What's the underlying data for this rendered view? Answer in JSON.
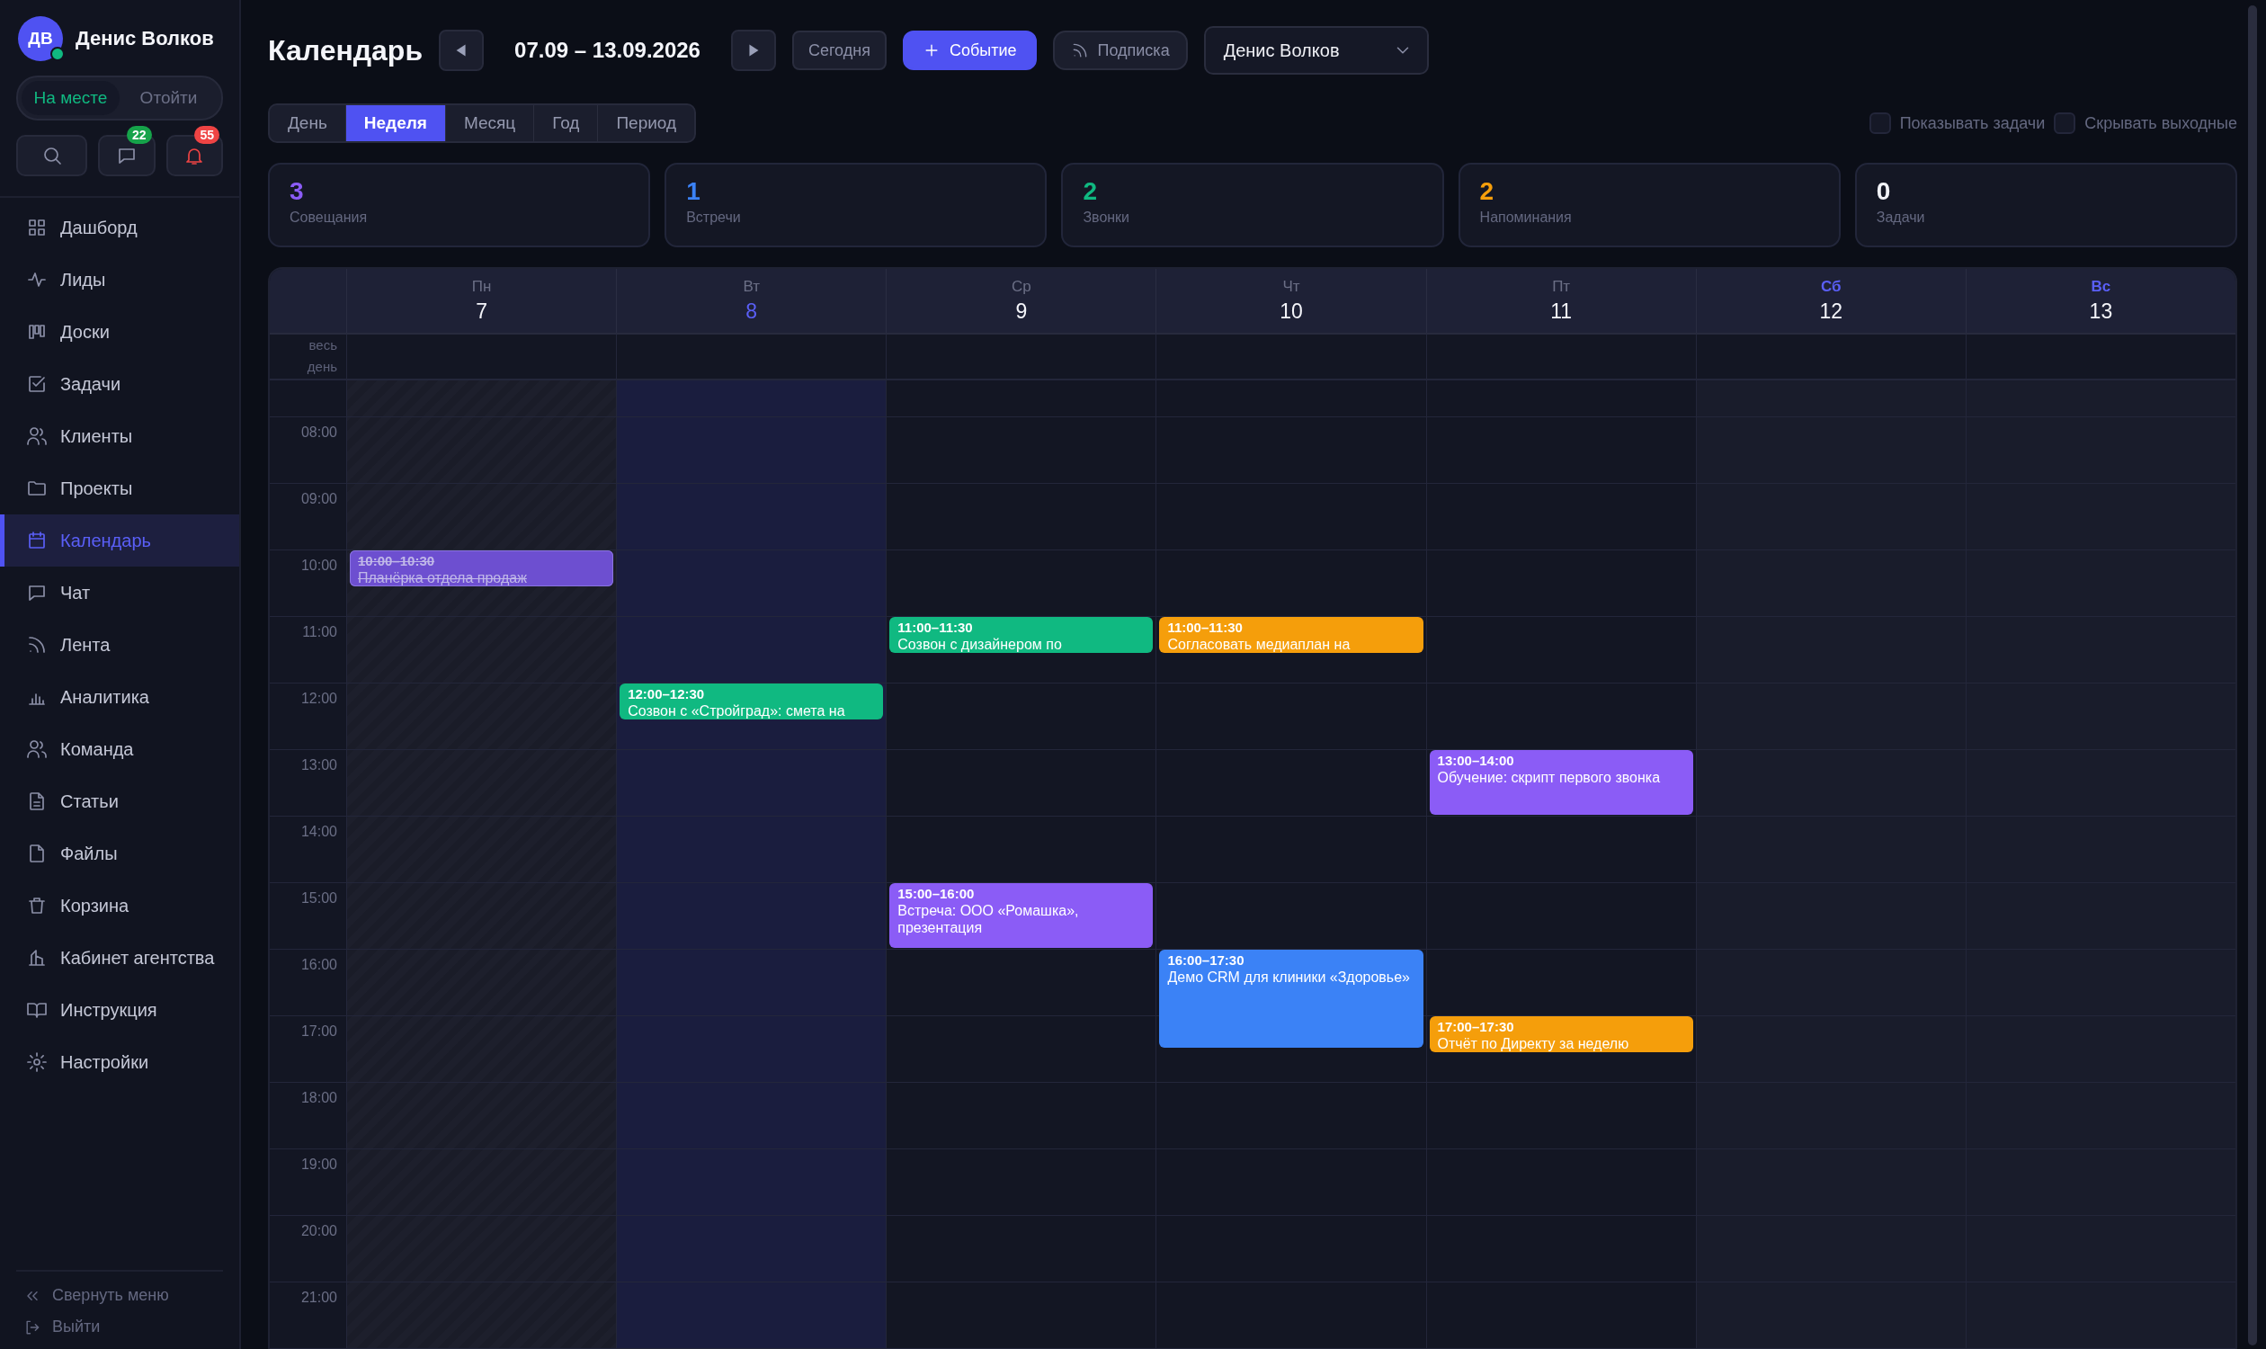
{
  "sidebar": {
    "user": {
      "initials": "ДВ",
      "name": "Денис Волков",
      "online": true
    },
    "status": [
      {
        "label": "На месте",
        "selected": true
      },
      {
        "label": "Отойти",
        "selected": false
      }
    ],
    "badges": [
      "22",
      "55"
    ],
    "items": [
      {
        "label": "Дашборд",
        "selected": false
      },
      {
        "label": "Лиды",
        "selected": false
      },
      {
        "label": "Доски",
        "selected": false
      },
      {
        "label": "Задачи",
        "selected": false
      },
      {
        "label": "Клиенты",
        "selected": false
      },
      {
        "label": "Проекты",
        "selected": false
      },
      {
        "label": "Календарь",
        "selected": true
      },
      {
        "label": "Чат",
        "selected": false
      },
      {
        "label": "Лента",
        "selected": false
      },
      {
        "label": "Аналитика",
        "selected": false
      },
      {
        "label": "Команда",
        "selected": false
      },
      {
        "label": "Статьи",
        "selected": false
      },
      {
        "label": "Файлы",
        "selected": false
      },
      {
        "label": "Корзина",
        "selected": false
      },
      {
        "label": "Кабинет агентства",
        "selected": false
      },
      {
        "label": "Инструкция",
        "selected": false
      },
      {
        "label": "Настройки",
        "selected": false
      }
    ],
    "collapse": "Свернуть меню",
    "logout": "Выйти"
  },
  "toolbar": {
    "title": "Календарь",
    "range": "07.09 – 13.09.2026",
    "today": "Сегодня",
    "new_event": "Событие",
    "subscribe": "Подписка",
    "user_select": "Денис Волков"
  },
  "views": [
    {
      "label": "День",
      "selected": false
    },
    {
      "label": "Неделя",
      "selected": true
    },
    {
      "label": "Месяц",
      "selected": false
    },
    {
      "label": "Год",
      "selected": false
    },
    {
      "label": "Период",
      "selected": false
    }
  ],
  "options": [
    {
      "label": "Показывать задачи",
      "checked": false
    },
    {
      "label": "Скрывать выходные",
      "checked": false
    }
  ],
  "stats": [
    {
      "value": "3",
      "label": "Совещания",
      "color": "#8b5cf6"
    },
    {
      "value": "1",
      "label": "Встречи",
      "color": "#3b82f6"
    },
    {
      "value": "2",
      "label": "Звонки",
      "color": "#10b981"
    },
    {
      "value": "2",
      "label": "Напоминания",
      "color": "#f59e0b"
    },
    {
      "value": "0",
      "label": "Задачи",
      "color": "#f1f2f7"
    }
  ],
  "all_day_label": "весь день",
  "hours": [
    "08:00",
    "09:00",
    "10:00",
    "11:00",
    "12:00",
    "13:00",
    "14:00",
    "15:00",
    "16:00",
    "17:00",
    "18:00",
    "19:00",
    "20:00",
    "21:00"
  ],
  "days": [
    {
      "weekday": "Пн",
      "date": "7",
      "kind": "past",
      "events": [
        {
          "time": "10:00–10:30",
          "title": "Планёрка отдела продаж",
          "color": "#6d4fd0",
          "done": true
        }
      ]
    },
    {
      "weekday": "Вт",
      "date": "8",
      "kind": "today",
      "events": [
        {
          "time": "12:00–12:30",
          "title": "Созвон с «Стройград»: смета на",
          "color": "#10b981",
          "done": false
        }
      ]
    },
    {
      "weekday": "Ср",
      "date": "9",
      "kind": "normal",
      "events": [
        {
          "time": "11:00–11:30",
          "title": "Созвон с дизайнером по",
          "color": "#10b981",
          "done": false
        },
        {
          "time": "15:00–16:00",
          "title": "Встреча: ООО «Ромашка», презентация",
          "color": "#8b5cf6",
          "done": false
        }
      ]
    },
    {
      "weekday": "Чт",
      "date": "10",
      "kind": "normal",
      "events": [
        {
          "time": "11:00–11:30",
          "title": "Согласовать медиаплан на",
          "color": "#f59e0b",
          "done": false
        },
        {
          "time": "16:00–17:30",
          "title": "Демо CRM для клиники «Здоровье»",
          "color": "#3b82f6",
          "done": false
        }
      ]
    },
    {
      "weekday": "Пт",
      "date": "11",
      "kind": "normal",
      "events": [
        {
          "time": "13:00–14:00",
          "title": "Обучение: скрипт первого звонка",
          "color": "#8b5cf6",
          "done": false
        },
        {
          "time": "17:00–17:30",
          "title": "Отчёт по Директу за неделю",
          "color": "#f59e0b",
          "done": false
        }
      ]
    },
    {
      "weekday": "Сб",
      "date": "12",
      "kind": "weekend"
    },
    {
      "weekday": "Вс",
      "date": "13",
      "kind": "weekend"
    }
  ]
}
